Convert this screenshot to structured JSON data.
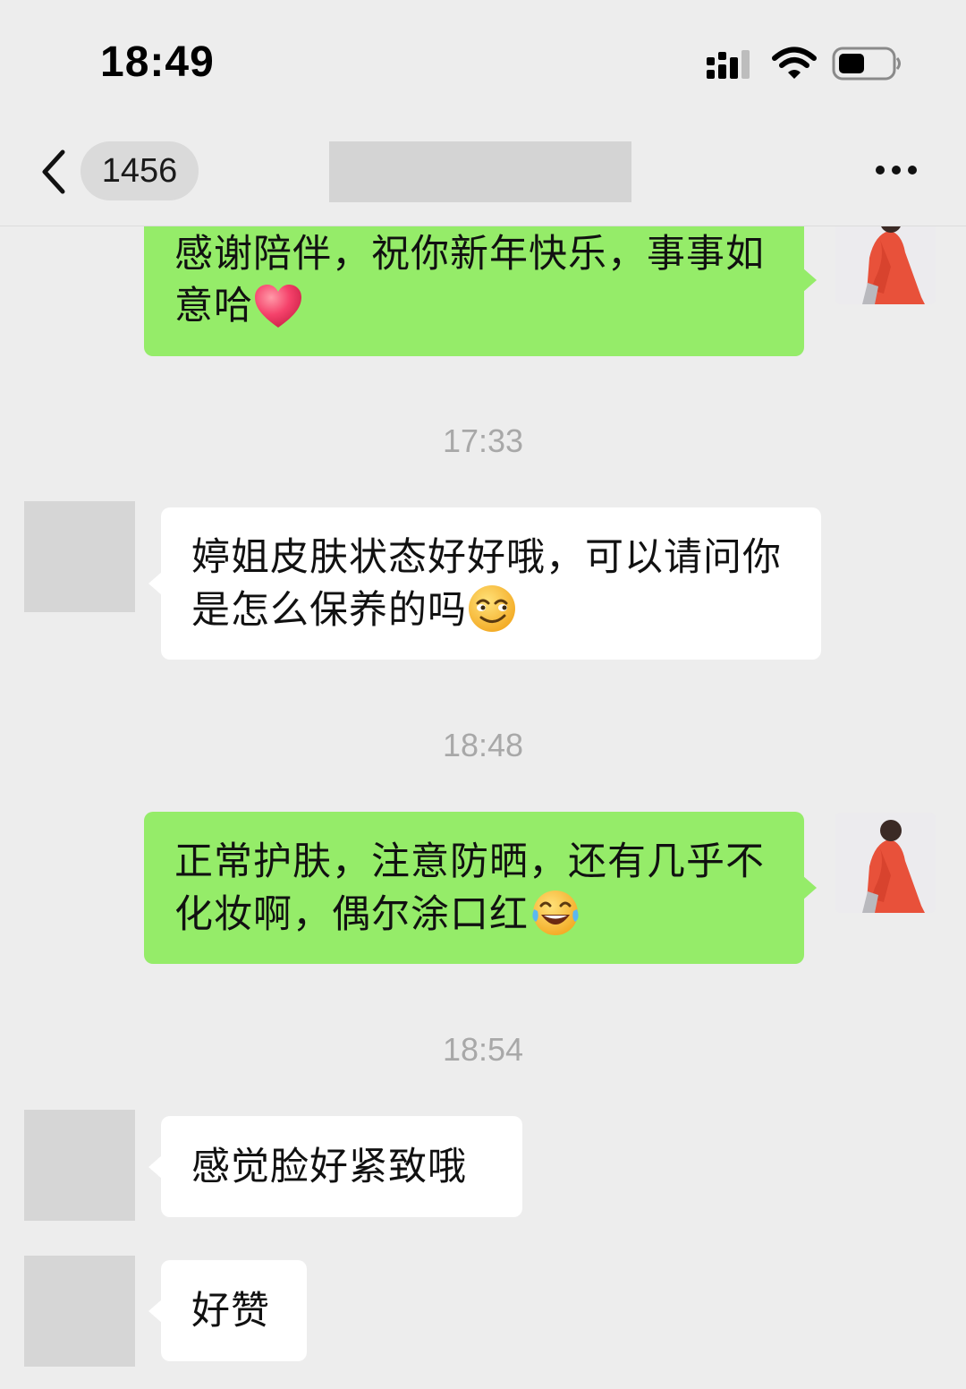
{
  "status_bar": {
    "time": "18:49"
  },
  "nav": {
    "unread_count": "1456"
  },
  "messages": [
    {
      "sender": "self",
      "text": "感谢陪伴，祝你新年快乐，事事如意哈",
      "emoji": "heart-emoji"
    },
    {
      "type": "time",
      "text": "17:33"
    },
    {
      "sender": "other",
      "text": "婷姐皮肤状态好好哦，可以请问你是怎么保养的吗",
      "emoji": "smirk-emoji"
    },
    {
      "type": "time",
      "text": "18:48"
    },
    {
      "sender": "self",
      "text": "正常护肤，注意防晒，还有几乎不化妆啊，偶尔涂口红",
      "emoji": "laugh-tears-emoji"
    },
    {
      "type": "time",
      "text": "18:54"
    },
    {
      "sender": "other",
      "text": "感觉脸好紧致哦"
    },
    {
      "sender": "other",
      "text": "好赞"
    }
  ],
  "colors": {
    "background": "#ededed",
    "self_bubble": "#95ec69",
    "other_bubble": "#ffffff",
    "timestamp": "#a8a8a8"
  }
}
